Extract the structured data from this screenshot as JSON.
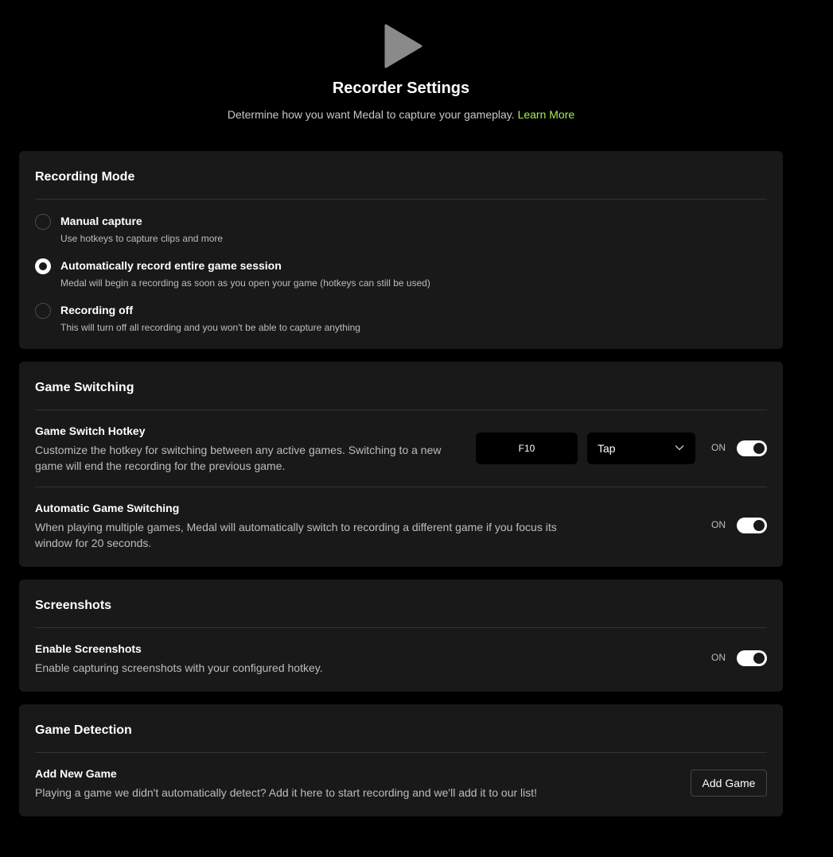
{
  "header": {
    "icon": "play-icon",
    "title": "Recorder Settings",
    "subtitle": "Determine how you want Medal to capture your gameplay.",
    "learn_more": "Learn More",
    "accent_color": "#a6f04c"
  },
  "recording_mode": {
    "title": "Recording Mode",
    "options": [
      {
        "label": "Manual capture",
        "desc": "Use hotkeys to capture clips and more",
        "selected": false
      },
      {
        "label": "Automatically record entire game session",
        "desc": "Medal will begin a recording as soon as you open your game (hotkeys can still be used)",
        "selected": true
      },
      {
        "label": "Recording off",
        "desc": "This will turn off all recording and you won't be able to capture anything",
        "selected": false
      }
    ]
  },
  "game_switching": {
    "title": "Game Switching",
    "hotkey": {
      "label": "Game Switch Hotkey",
      "desc": "Customize the hotkey for switching between any active games. Switching to a new game will end the recording for the previous game.",
      "key": "F10",
      "mode": "Tap",
      "toggle_text": "ON",
      "enabled": true
    },
    "auto": {
      "label": "Automatic Game Switching",
      "desc": "When playing multiple games, Medal will automatically switch to recording a different game if you focus its window for 20 seconds.",
      "toggle_text": "ON",
      "enabled": true
    }
  },
  "screenshots": {
    "title": "Screenshots",
    "label": "Enable Screenshots",
    "desc": "Enable capturing screenshots with your configured hotkey.",
    "toggle_text": "ON",
    "enabled": true
  },
  "game_detection": {
    "title": "Game Detection",
    "label": "Add New Game",
    "desc": "Playing a game we didn't automatically detect? Add it here to start recording and we'll add it to our list!",
    "button": "Add Game"
  }
}
